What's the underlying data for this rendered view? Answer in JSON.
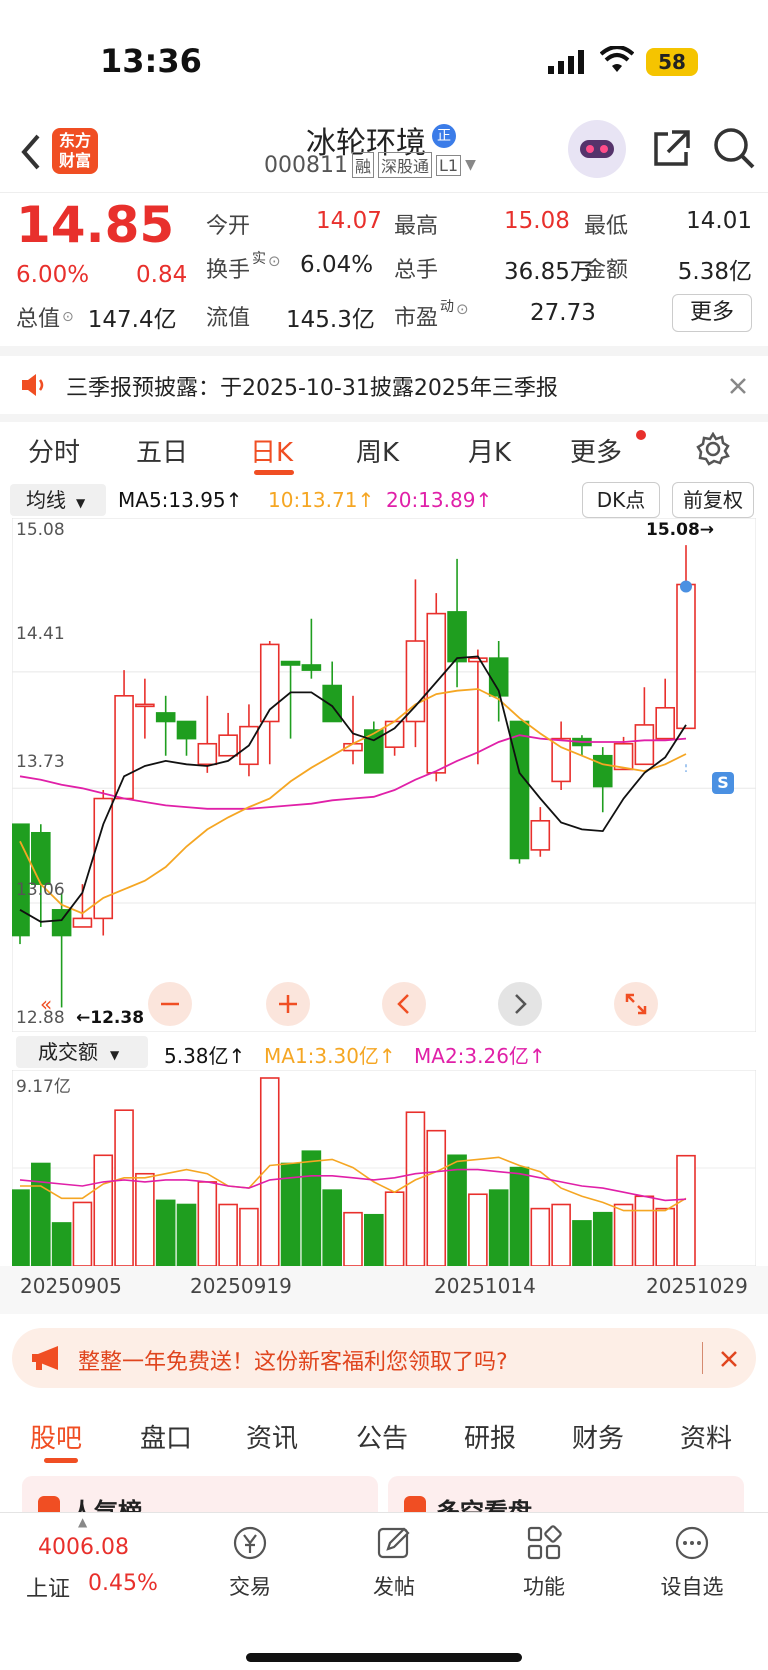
{
  "status": {
    "time": "13:36",
    "battery": "58"
  },
  "header": {
    "logo_line1": "东方",
    "logo_line2": "财富",
    "stock_name": "冰轮环境",
    "badge": "正",
    "code": "000811",
    "tag_rong": "融",
    "tag_sgt": "深股通",
    "tag_l1": "L1"
  },
  "quote": {
    "price": "14.85",
    "pct": "6.00%",
    "chg": "0.84",
    "rows": [
      [
        {
          "label": "今开",
          "value": "14.07",
          "cls": "red"
        },
        {
          "label": "最高",
          "value": "15.08",
          "cls": "red"
        },
        {
          "label": "最低",
          "value": "14.01",
          "cls": ""
        }
      ],
      [
        {
          "label": "换手",
          "sup": "实",
          "value": "6.04%",
          "cls": ""
        },
        {
          "label": "总手",
          "value": "36.85万",
          "cls": ""
        },
        {
          "label": "金额",
          "value": "5.38亿",
          "cls": ""
        }
      ],
      [
        {
          "label": "总值",
          "value": "147.4亿",
          "cls": ""
        },
        {
          "label": "流值",
          "value": "145.3亿",
          "cls": ""
        },
        {
          "label": "市盈",
          "sup": "动",
          "value": "27.73",
          "cls": ""
        }
      ]
    ],
    "more": "更多"
  },
  "notice": {
    "text": "三季报预披露：于2025-10-31披露2025年三季报"
  },
  "period_tabs": [
    "分时",
    "五日",
    "日K",
    "周K",
    "月K",
    "更多"
  ],
  "active_tab": "日K",
  "indicator": {
    "selector": "均线",
    "ma5": "MA5:13.95↑",
    "ma10": "10:13.71↑",
    "ma20": "20:13.89↑",
    "dk": "DK点",
    "fq": "前复权"
  },
  "kline": {
    "y_labels": [
      "15.08",
      "14.41",
      "13.73",
      "13.06",
      "12.88"
    ],
    "max_label": "15.08→",
    "min_label": "←12.38",
    "signal": "S"
  },
  "volume": {
    "selector": "成交额",
    "val": "5.38亿↑",
    "ma1": "MA1:3.30亿↑",
    "ma2": "MA2:3.26亿↑",
    "max": "9.17亿"
  },
  "dates": [
    "20250905",
    "20250919",
    "20251014",
    "20251029"
  ],
  "promo": {
    "text": "整整一年免费送！这份新客福利您领取了吗?"
  },
  "bottom_tabs": [
    "股吧",
    "盘口",
    "资讯",
    "公告",
    "研报",
    "财务",
    "资料"
  ],
  "cards": [
    "人气榜",
    "多空看盘"
  ],
  "footer": {
    "index_value": "4006.08",
    "index_name": "上证",
    "index_pct": "0.45%",
    "trade": "交易",
    "post": "发帖",
    "func": "功能",
    "watch": "设自选"
  },
  "chart_data": {
    "type": "candlestick",
    "y_axis": [
      12.38,
      15.08
    ],
    "candles": [
      {
        "o": 13.45,
        "c": 12.8,
        "h": 13.45,
        "l": 12.75
      },
      {
        "o": 13.4,
        "c": 13.1,
        "h": 13.45,
        "l": 12.85
      },
      {
        "o": 12.95,
        "c": 12.8,
        "h": 13.05,
        "l": 12.38
      },
      {
        "o": 12.85,
        "c": 12.9,
        "h": 13.1,
        "l": 12.85
      },
      {
        "o": 12.9,
        "c": 13.6,
        "h": 13.65,
        "l": 12.8
      },
      {
        "o": 13.6,
        "c": 14.2,
        "h": 14.35,
        "l": 13.6
      },
      {
        "o": 14.15,
        "c": 14.15,
        "h": 14.3,
        "l": 13.95
      },
      {
        "o": 14.1,
        "c": 14.05,
        "h": 14.2,
        "l": 13.85
      },
      {
        "o": 14.05,
        "c": 13.95,
        "h": 14.05,
        "l": 13.85
      },
      {
        "o": 13.8,
        "c": 13.92,
        "h": 14.2,
        "l": 13.75
      },
      {
        "o": 13.85,
        "c": 13.97,
        "h": 14.1,
        "l": 13.85
      },
      {
        "o": 13.8,
        "c": 14.02,
        "h": 14.15,
        "l": 13.73
      },
      {
        "o": 14.05,
        "c": 14.5,
        "h": 14.52,
        "l": 13.8
      },
      {
        "o": 14.4,
        "c": 14.38,
        "h": 14.4,
        "l": 13.95
      },
      {
        "o": 14.38,
        "c": 14.35,
        "h": 14.65,
        "l": 14.3
      },
      {
        "o": 14.26,
        "c": 14.05,
        "h": 14.4,
        "l": 14.05
      },
      {
        "o": 13.88,
        "c": 13.92,
        "h": 14.2,
        "l": 13.8
      },
      {
        "o": 14.0,
        "c": 13.75,
        "h": 14.05,
        "l": 13.75
      },
      {
        "o": 13.9,
        "c": 14.05,
        "h": 14.05,
        "l": 13.85
      },
      {
        "o": 14.05,
        "c": 14.52,
        "h": 14.88,
        "l": 13.9
      },
      {
        "o": 13.75,
        "c": 14.68,
        "h": 14.8,
        "l": 13.7
      },
      {
        "o": 14.69,
        "c": 14.4,
        "h": 15.0,
        "l": 14.25
      },
      {
        "o": 14.4,
        "c": 14.42,
        "h": 14.47,
        "l": 13.8
      },
      {
        "o": 14.42,
        "c": 14.2,
        "h": 14.52,
        "l": 14.05
      },
      {
        "o": 14.05,
        "c": 13.25,
        "h": 14.05,
        "l": 13.22
      },
      {
        "o": 13.3,
        "c": 13.47,
        "h": 13.55,
        "l": 13.26
      },
      {
        "o": 13.7,
        "c": 13.95,
        "h": 14.05,
        "l": 13.65
      },
      {
        "o": 13.95,
        "c": 13.91,
        "h": 13.97,
        "l": 13.85
      },
      {
        "o": 13.85,
        "c": 13.67,
        "h": 13.9,
        "l": 13.52
      },
      {
        "o": 13.77,
        "c": 13.92,
        "h": 13.96,
        "l": 13.77
      },
      {
        "o": 13.8,
        "c": 14.03,
        "h": 14.25,
        "l": 13.8
      },
      {
        "o": 13.95,
        "c": 14.13,
        "h": 14.3,
        "l": 13.95
      },
      {
        "o": 14.01,
        "c": 14.85,
        "h": 15.08,
        "l": 14.01
      }
    ],
    "volumes": [
      3.7,
      5.0,
      2.1,
      3.1,
      5.4,
      7.6,
      4.5,
      3.2,
      3.0,
      4.1,
      3.0,
      2.8,
      9.17,
      5.0,
      5.6,
      3.7,
      2.6,
      2.5,
      3.6,
      7.5,
      6.6,
      5.4,
      3.5,
      3.7,
      4.8,
      2.8,
      3.0,
      2.2,
      2.6,
      3.0,
      3.4,
      2.8,
      5.38
    ],
    "ma5": [
      12.95,
      12.88,
      12.89,
      13.05,
      13.45,
      13.73,
      13.79,
      13.82,
      13.8,
      13.79,
      13.82,
      13.91,
      14.12,
      14.22,
      14.22,
      14.14,
      13.98,
      13.94,
      14.01,
      14.14,
      14.28,
      14.42,
      14.43,
      14.23,
      13.75,
      13.6,
      13.46,
      13.42,
      13.41,
      13.6,
      13.75,
      13.84,
      14.03
    ],
    "ma10": [
      13.35,
      13.1,
      12.98,
      12.93,
      13.02,
      13.07,
      13.12,
      13.2,
      13.32,
      13.42,
      13.49,
      13.55,
      13.6,
      13.7,
      13.78,
      13.85,
      13.92,
      13.98,
      14.05,
      14.15,
      14.21,
      14.23,
      14.24,
      14.18,
      14.07,
      13.98,
      13.9,
      13.85,
      13.8,
      13.78,
      13.76,
      13.8,
      13.86
    ],
    "ma20": [
      13.73,
      13.71,
      13.68,
      13.66,
      13.63,
      13.6,
      13.58,
      13.56,
      13.55,
      13.54,
      13.54,
      13.54,
      13.55,
      13.56,
      13.57,
      13.59,
      13.6,
      13.61,
      13.65,
      13.71,
      13.76,
      13.82,
      13.87,
      13.93,
      13.97,
      13.95,
      13.94,
      13.93,
      13.93,
      13.93,
      13.94,
      13.94,
      13.95
    ],
    "vol_ma1": [
      3.9,
      3.9,
      3.3,
      3.3,
      4.0,
      4.3,
      4.3,
      4.5,
      4.7,
      4.5,
      3.9,
      3.8,
      4.9,
      5.0,
      5.1,
      5.2,
      4.8,
      4.1,
      3.6,
      4.2,
      4.6,
      5.1,
      5.2,
      5.3,
      4.9,
      4.6,
      3.8,
      3.4,
      3.1,
      2.7,
      2.7,
      2.7,
      3.3
    ],
    "vol_ma2": [
      4.2,
      4.1,
      4.0,
      3.9,
      4.1,
      4.2,
      4.1,
      4.2,
      4.2,
      4.1,
      3.9,
      3.8,
      4.2,
      4.3,
      4.4,
      4.4,
      4.3,
      4.2,
      4.3,
      4.5,
      4.6,
      4.7,
      4.7,
      4.6,
      4.5,
      4.3,
      4.1,
      3.9,
      3.8,
      3.6,
      3.4,
      3.2,
      3.26
    ]
  }
}
